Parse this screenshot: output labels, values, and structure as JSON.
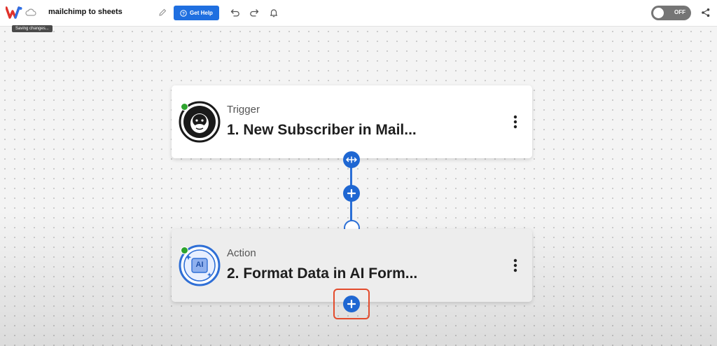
{
  "header": {
    "saving_tooltip": "Saving changes...",
    "workflow_title": "mailchimp to sheets",
    "help_label": "Get Help",
    "toggle_state": "OFF"
  },
  "steps": [
    {
      "kind": "Trigger",
      "title": "1. New Subscriber in Mail...",
      "icon": "mailchimp-icon",
      "status": "active"
    },
    {
      "kind": "Action",
      "title": "2. Format Data in AI Form...",
      "icon": "ai-formatter-icon",
      "status": "active",
      "icon_text": "AI"
    }
  ],
  "colors": {
    "accent": "#1f6fe0",
    "connector": "#2b6fd6",
    "status_green": "#2da32d",
    "highlight": "#e34b2c"
  }
}
